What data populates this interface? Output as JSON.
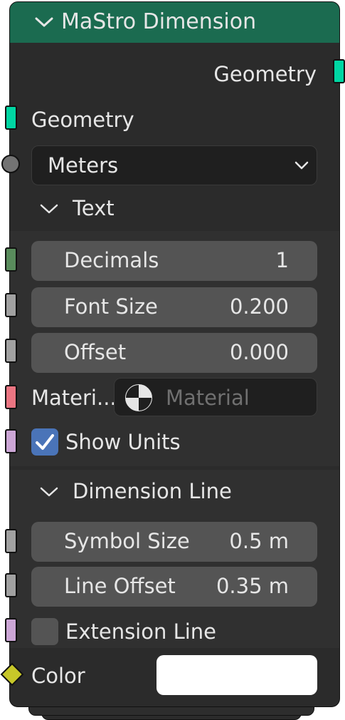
{
  "node": {
    "title": "MaStro Dimension",
    "header_color": "#1b6b50",
    "output_geometry_label": "Geometry",
    "input_geometry_label": "Geometry",
    "unit_dropdown_value": "Meters",
    "text_section": {
      "label": "Text",
      "decimals": {
        "label": "Decimals",
        "value": "1"
      },
      "font_size": {
        "label": "Font Size",
        "value": "0.200"
      },
      "offset": {
        "label": "Offset",
        "value": "0.000"
      },
      "material_label": "Materi...",
      "material_placeholder": "Material",
      "show_units": {
        "label": "Show Units",
        "checked": true
      }
    },
    "dimension_line_section": {
      "label": "Dimension Line",
      "symbol_size": {
        "label": "Symbol Size",
        "value": "0.5 m"
      },
      "line_offset": {
        "label": "Line Offset",
        "value": "0.35 m"
      },
      "extension_line": {
        "label": "Extension Line",
        "checked": false
      }
    },
    "color_label": "Color",
    "color_value": "#ffffff",
    "socket_colors": {
      "geometry": "#00d6a3",
      "unit": "#a1a1a1",
      "integer": "#598c5c",
      "float": "#a1a1a1",
      "material": "#eb7582",
      "boolean": "#cca6d6",
      "color": "#c7c729"
    }
  }
}
